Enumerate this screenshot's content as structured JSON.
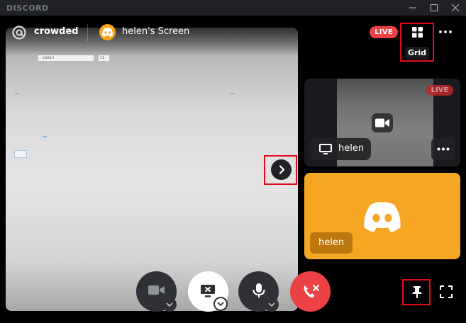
{
  "titlebar": {
    "wordmark": "DISCORD",
    "controls": [
      "minimize-icon",
      "maximize-icon",
      "close-icon"
    ]
  },
  "header": {
    "channel_icon": "at-icon",
    "channel_name": "crowded",
    "stream_avatar_icon": "discord-logo-icon",
    "stream_title": "helen's Screen",
    "live_label": "LIVE",
    "grid_icon": "grid-icon",
    "grid_tooltip": "Grid",
    "more_icon": "more-horizontal-icon"
  },
  "stream": {
    "doc_font_name": "Calibri",
    "doc_font_size": "11",
    "next_icon": "chevron-right-icon"
  },
  "participants": [
    {
      "name": "helen",
      "live_label": "LIVE",
      "badge_icon": "monitor-icon",
      "center_icon": "video-camera-icon",
      "more_icon": "more-horizontal-icon"
    },
    {
      "name": "helen",
      "avatar_icon": "discord-logo-icon",
      "tile_color": "#f5a623"
    }
  ],
  "controls": {
    "camera_icon": "video-camera-icon",
    "screen_share_icon": "stop-screen-share-icon",
    "mic_icon": "microphone-icon",
    "hangup_icon": "hang-up-icon",
    "chevron_icon": "chevron-down-icon",
    "pin_icon": "pin-icon",
    "fullscreen_icon": "fullscreen-icon"
  },
  "colors": {
    "live_red": "#ed4245",
    "highlight_red": "#e10b1c",
    "titlebar": "#202225",
    "tile_orange": "#f5a623"
  }
}
